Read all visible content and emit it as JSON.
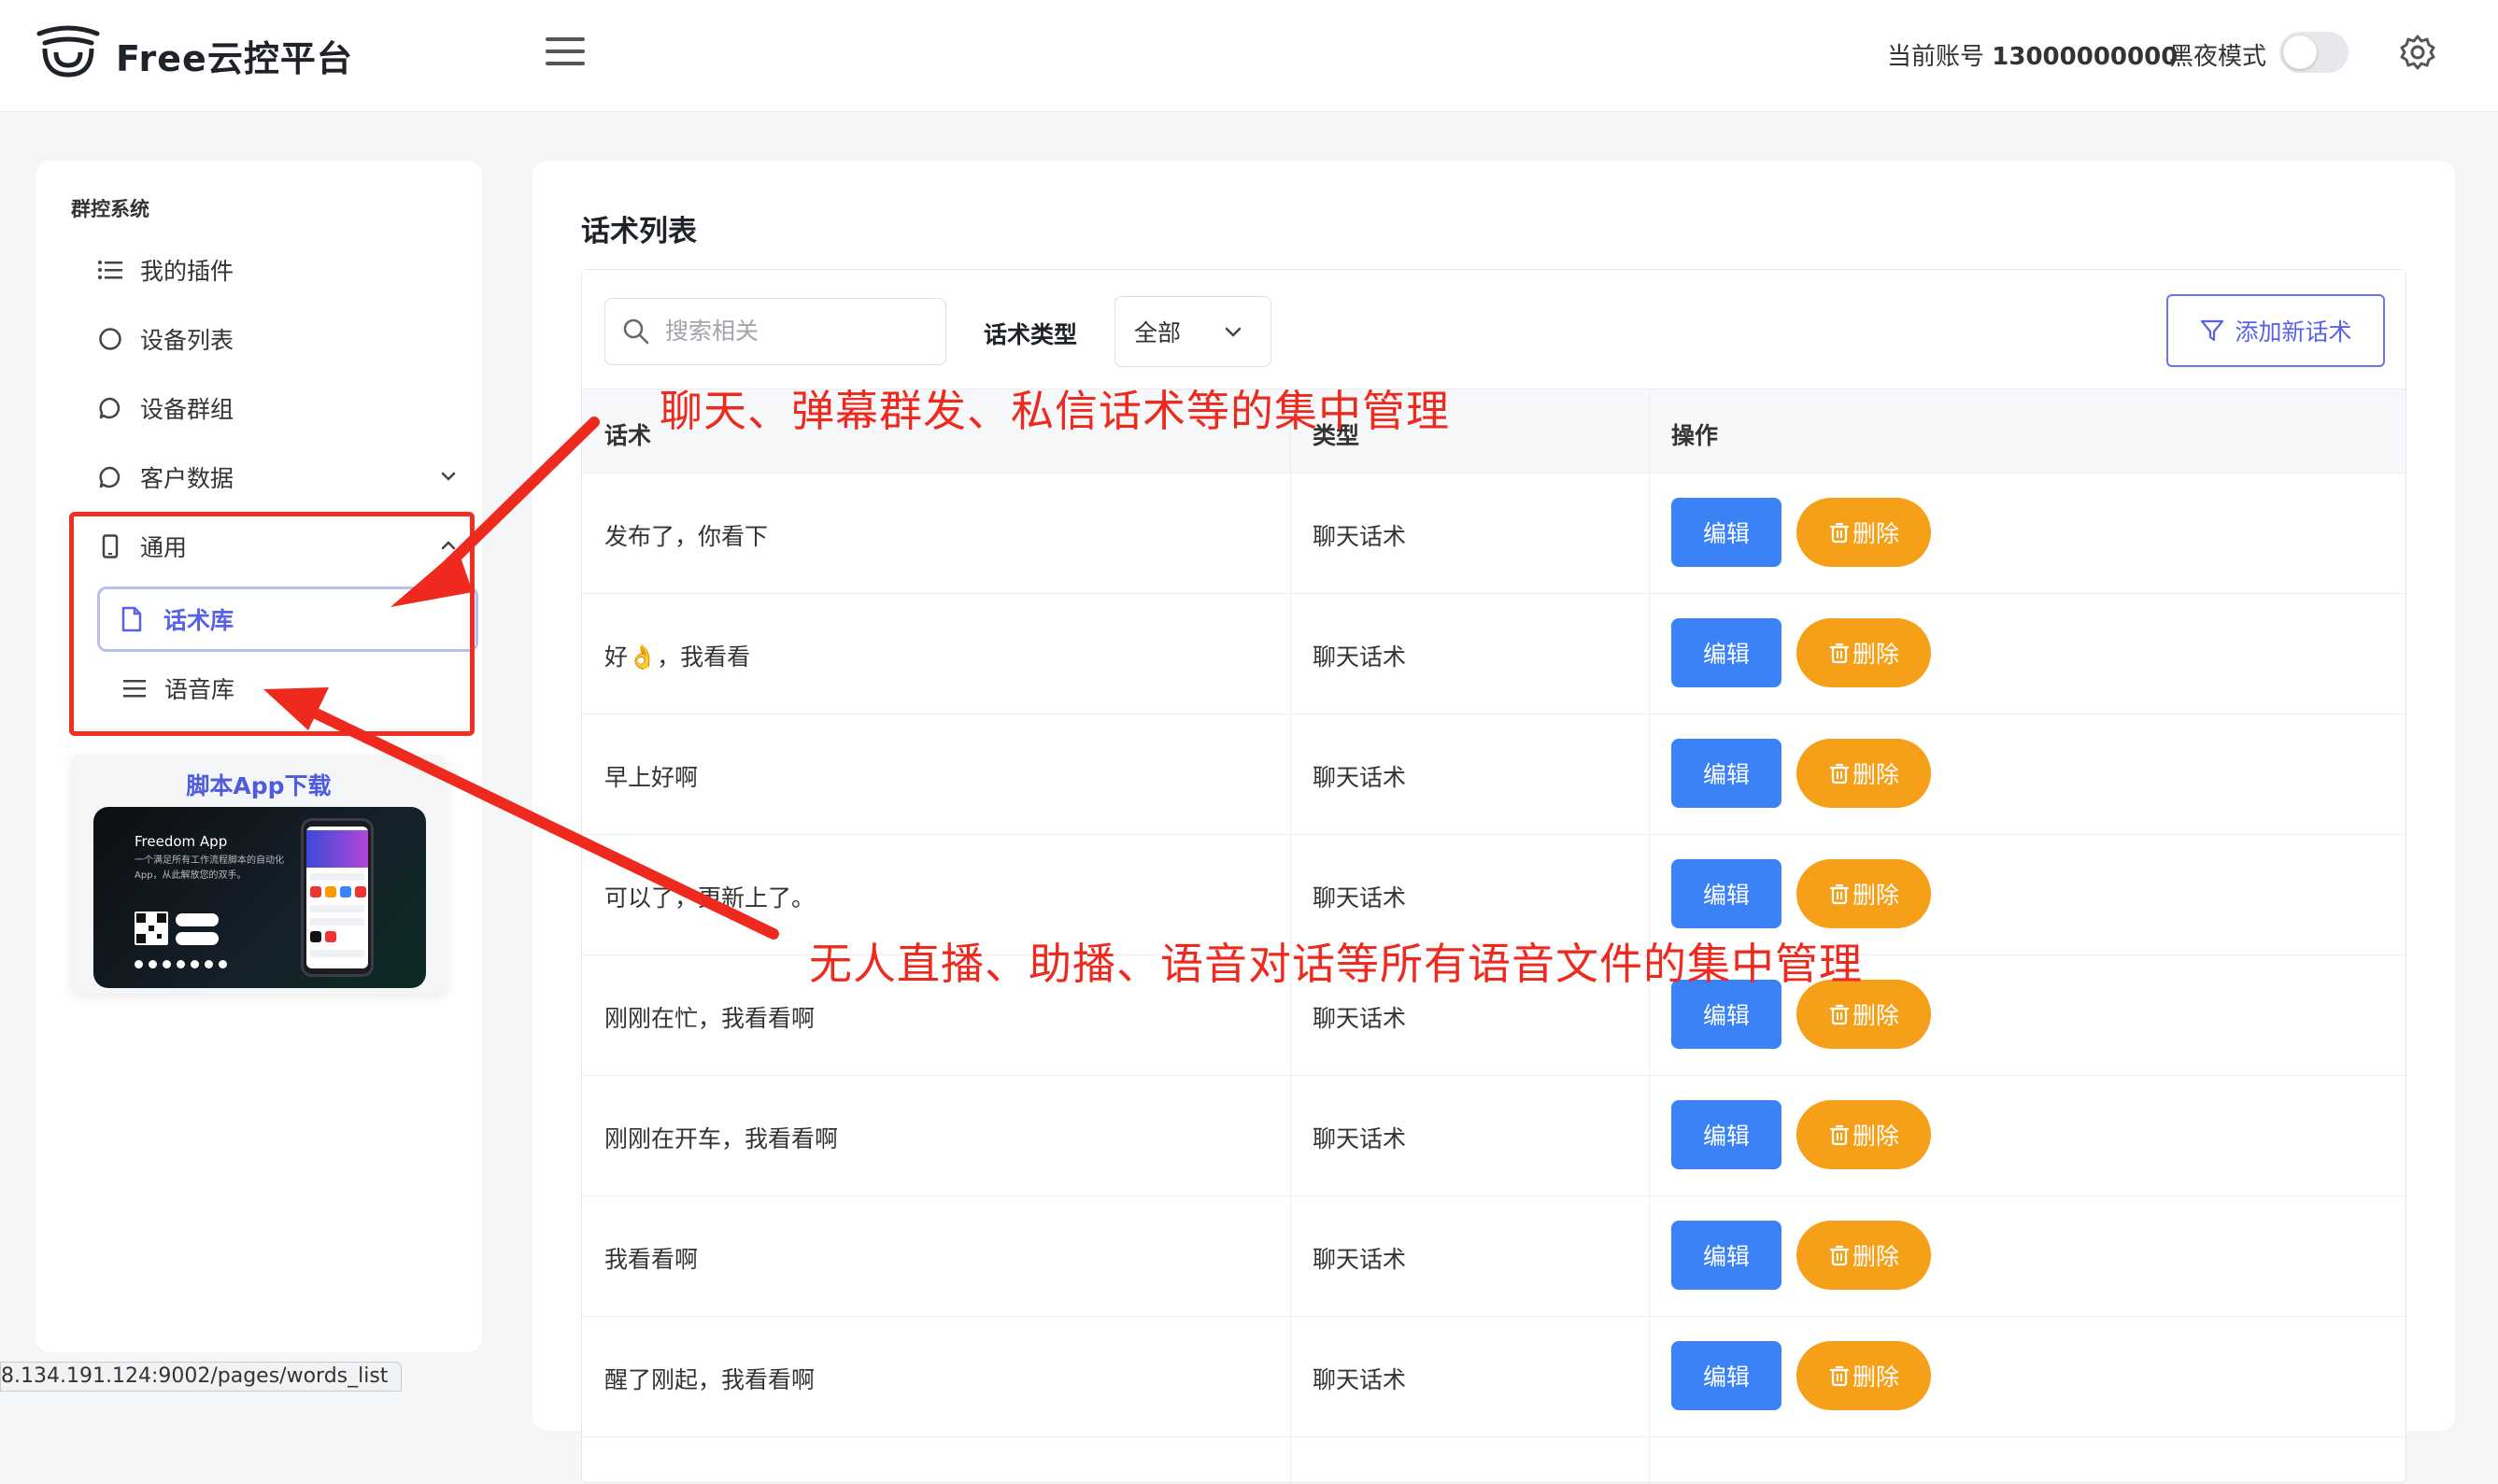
{
  "header": {
    "brand": "Free云控平台",
    "account_label": "当前账号",
    "account_number": "13000000000",
    "dark_mode_label": "黑夜模式",
    "dark_mode_on": false
  },
  "sidebar": {
    "section_title": "群控系统",
    "items": [
      {
        "label": "我的插件",
        "icon": "list-icon"
      },
      {
        "label": "设备列表",
        "icon": "circle-icon"
      },
      {
        "label": "设备群组",
        "icon": "chat-bubble-icon"
      },
      {
        "label": "客户数据",
        "icon": "chat-bubble-icon",
        "expandable": true
      },
      {
        "label": "通用",
        "icon": "phone-icon",
        "expandable": true
      }
    ],
    "sub_items": [
      {
        "label": "话术库",
        "icon": "file-icon",
        "active": true
      },
      {
        "label": "语音库",
        "icon": "lines-icon",
        "active": false
      }
    ],
    "app_download": {
      "title": "脚本App下载",
      "banner_title": "Freedom App",
      "banner_sub": "一个满足所有工作流程脚本的自动化App，从此解放您的双手。"
    }
  },
  "main": {
    "title": "话术列表",
    "search_placeholder": "搜索相关",
    "type_label": "话术类型",
    "type_selected": "全部",
    "add_button": "添加新话术",
    "columns": [
      "话术",
      "类型",
      "操作"
    ],
    "edit_label": "编辑",
    "delete_label": "删除",
    "rows": [
      {
        "text": "发布了，你看下",
        "type": "聊天话术"
      },
      {
        "text": "好👌，我看看",
        "type": "聊天话术"
      },
      {
        "text": "早上好啊",
        "type": "聊天话术"
      },
      {
        "text": "可以了，更新上了。",
        "type": "聊天话术"
      },
      {
        "text": "刚刚在忙，我看看啊",
        "type": "聊天话术"
      },
      {
        "text": "刚刚在开车，我看看啊",
        "type": "聊天话术"
      },
      {
        "text": "我看看啊",
        "type": "聊天话术"
      },
      {
        "text": "醒了刚起，我看看啊",
        "type": "聊天话术"
      }
    ]
  },
  "annotations": {
    "top": "聊天、弹幕群发、私信话术等的集中管理",
    "bottom": "无人直播、助播、语音对话等所有语音文件的集中管理",
    "color": "#ee2a1f"
  },
  "status_url": "8.134.191.124:9002/pages/words_list",
  "colors": {
    "accent": "#5862e8",
    "edit_button": "#3b82f6",
    "delete_button": "#f5a018"
  }
}
